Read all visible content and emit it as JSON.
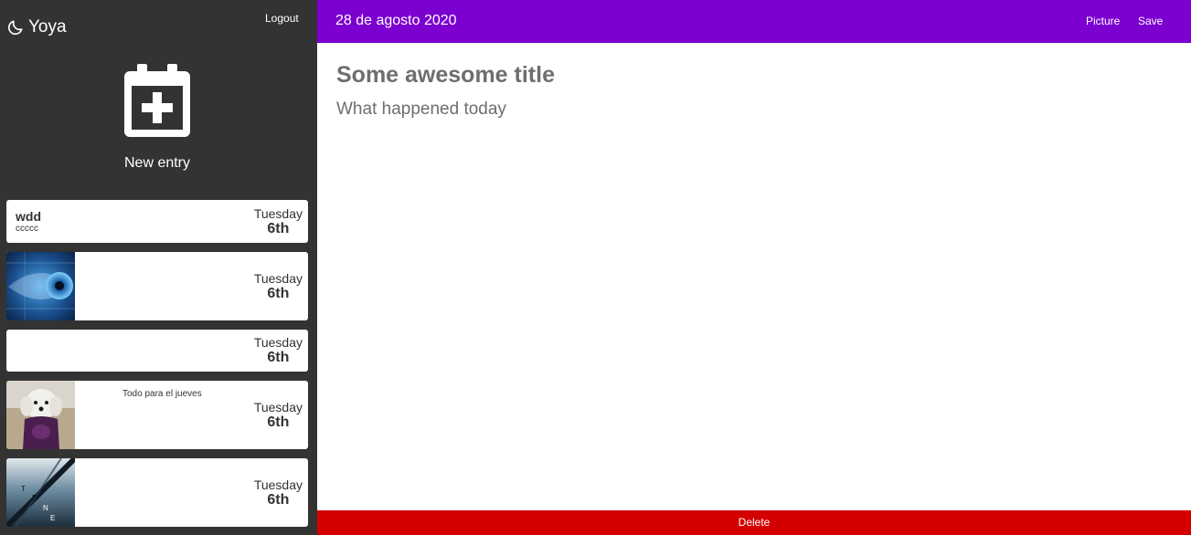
{
  "app": {
    "name": "Yoya",
    "logout_label": "Logout"
  },
  "sidebar": {
    "new_entry_label": "New entry",
    "entries": [
      {
        "title": "wdd",
        "subtitle": "ccccc",
        "day": "Tuesday",
        "date": "6th"
      },
      {
        "thumbnail": "eye-image",
        "day": "Tuesday",
        "date": "6th"
      },
      {
        "day": "Tuesday",
        "date": "6th"
      },
      {
        "thumbnail": "dog-image",
        "text": "Todo para el jueves",
        "day": "Tuesday",
        "date": "6th"
      },
      {
        "thumbnail": "poster-image",
        "day": "Tuesday",
        "date": "6th"
      }
    ]
  },
  "header": {
    "date": "28 de agosto 2020",
    "picture_label": "Picture",
    "save_label": "Save"
  },
  "editor": {
    "title_placeholder": "Some awesome title",
    "body_placeholder": "What happened today"
  },
  "footer": {
    "delete_label": "Delete"
  },
  "colors": {
    "sidebar": "#333333",
    "accent": "#7c00d0",
    "danger": "#d40000"
  }
}
